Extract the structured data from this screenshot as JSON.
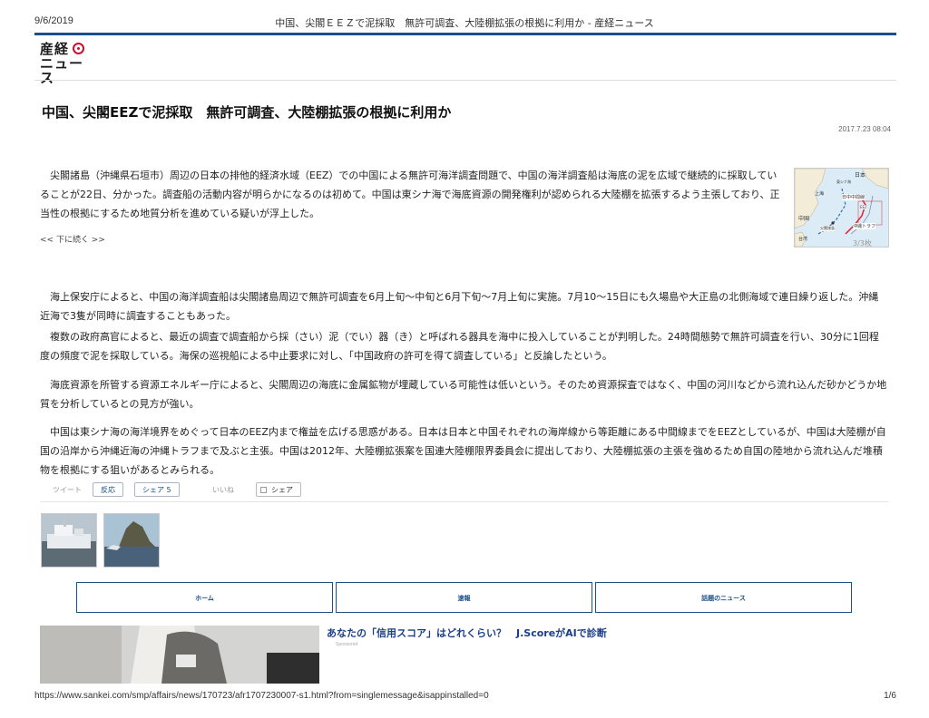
{
  "print_header": {
    "date": "9/6/2019",
    "title": "中国、尖閣ＥＥＺで泥採取　無許可調査、大陸棚拡張の根拠に利用か - 産経ニュース"
  },
  "logo": {
    "line1": "産経",
    "line2": "ニュース"
  },
  "article": {
    "headline": "中国、尖閣EEZで泥採取　無許可調査、大陸棚拡張の根拠に利用か",
    "date": "2017.7.23 08:04",
    "lead": "尖閣諸島（沖縄県石垣市）周辺の日本の排他的経済水域（EEZ）での中国による無許可海洋調査問題で、中国の海洋調査船は海底の泥を広域で継続的に採取していることが22日、分かった。調査船の活動内容が明らかになるのは初めて。中国は東シナ海で海底資源の開発権利が認められる大陸棚を拡張するよう主張しており、正当性の根拠にするため地質分析を進めている疑いが浮上した。",
    "next_link": "<< 下に続く >>",
    "map": {
      "labels": [
        "日本",
        "東シナ海",
        "上海",
        "日中中間線",
        "EEZ",
        "中国",
        "尖閣諸島",
        "沖縄トラフ",
        "台湾"
      ],
      "counter": "3/3枚"
    },
    "paragraphs": [
      "海上保安庁によると、中国の海洋調査船は尖閣諸島周辺で無許可調査を6月上旬～中旬と6月下旬～7月上旬に実施。7月10～15日にも久場島や大正島の北側海域で連日繰り返した。沖縄近海で3隻が同時に調査することもあった。",
      "複数の政府高官によると、最近の調査で調査船から採（さい）泥（でい）器（き）と呼ばれる器具を海中に投入していることが判明した。24時間態勢で無許可調査を行い、30分に1回程度の頻度で泥を採取している。海保の巡視船による中止要求に対し、「中国政府の許可を得て調査している」と反論したという。",
      "海底資源を所管する資源エネルギー庁によると、尖閣周辺の海底に金属鉱物が埋蔵している可能性は低いという。そのため資源探査ではなく、中国の河川などから流れ込んだ砂かどうか地質を分析しているとの見方が強い。",
      "中国は東シナ海の海洋境界をめぐって日本のEEZ内まで権益を広げる思惑がある。日本は日本と中国それぞれの海岸線から等距離にある中間線までをEEZとしているが、中国は大陸棚が自国の沿岸から沖縄近海の沖縄トラフまで及ぶと主張。中国は2012年、大陸棚拡張案を国連大陸棚限界委員会に提出しており、大陸棚拡張の主張を強めるため自国の陸地から流れ込んだ堆積物を根拠にする狙いがあるとみられる。"
    ]
  },
  "share": {
    "tweet": "ツイート",
    "react": "反応",
    "share_count": "シェア 5",
    "like": "いいね",
    "share": "シェア"
  },
  "nav": {
    "home": "ホーム",
    "breaking": "速報",
    "trending": "話題のニュース"
  },
  "ad": {
    "title": "あなたの「信用スコア」はどれくらい？　J.ScoreがAIで診断",
    "sponsored": "Sponsored"
  },
  "print_footer": {
    "url": "https://www.sankei.com/smp/affairs/news/170723/afr1707230007-s1.html?from=singlemessage&isappinstalled=0",
    "page": "1/6"
  },
  "colors": {
    "accent": "#1a4f8a",
    "brand_red": "#c8102e"
  }
}
